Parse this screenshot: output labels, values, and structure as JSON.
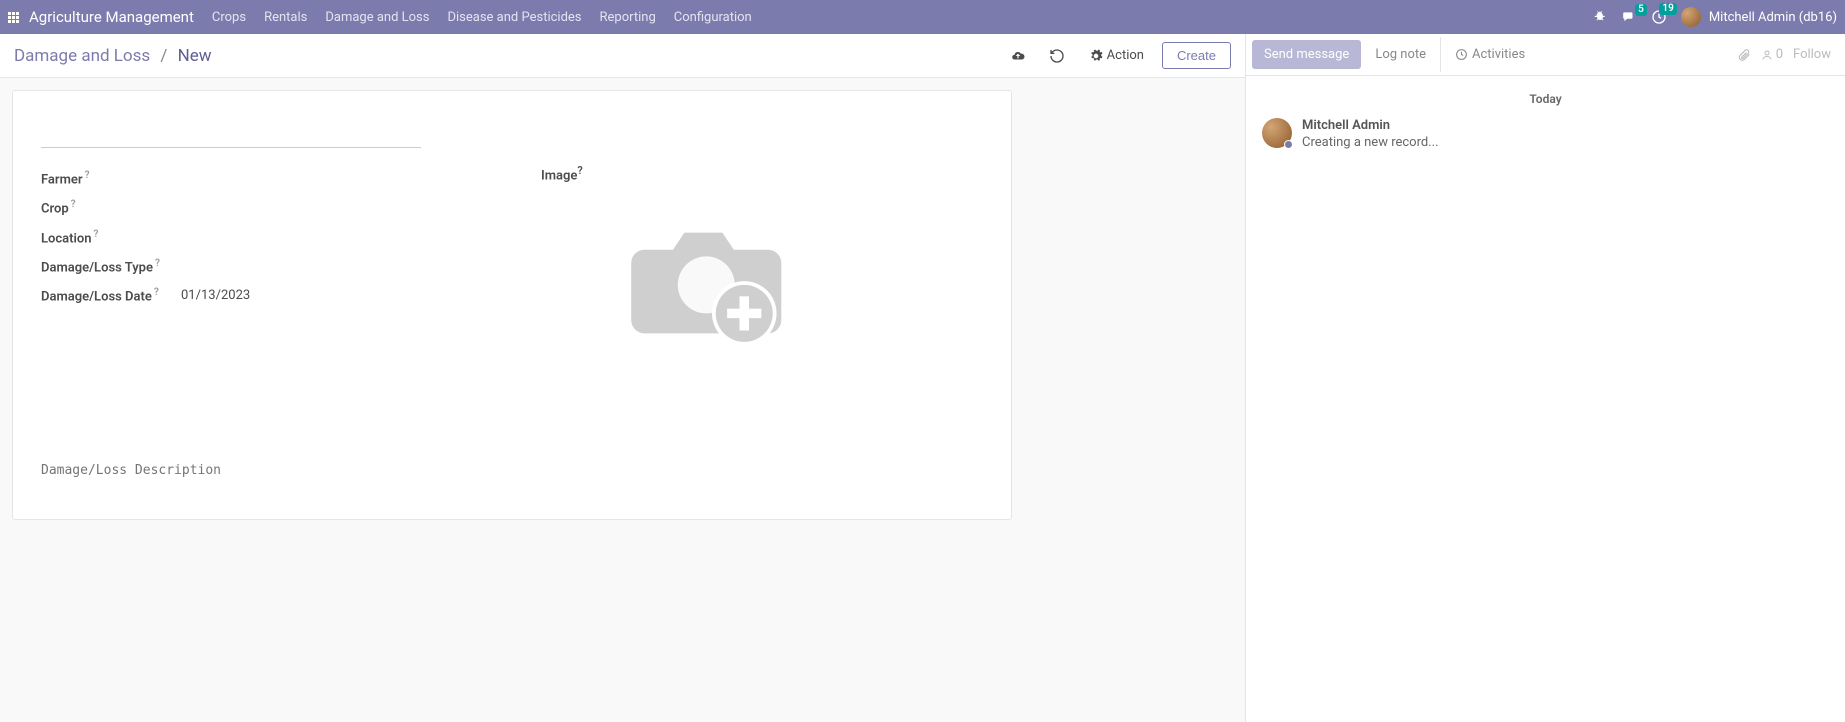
{
  "app": {
    "title": "Agriculture Management"
  },
  "nav": {
    "items": [
      "Crops",
      "Rentals",
      "Damage and Loss",
      "Disease and Pesticides",
      "Reporting",
      "Configuration"
    ]
  },
  "badges": {
    "chat": "5",
    "activities": "19"
  },
  "user": {
    "name": "Mitchell Admin (db16)"
  },
  "breadcrumb": {
    "root": "Damage and Loss",
    "current": "New"
  },
  "controls": {
    "action": "Action",
    "create": "Create"
  },
  "form": {
    "fields": {
      "farmer": "Farmer",
      "crop": "Crop",
      "location": "Location",
      "type": "Damage/Loss Type",
      "date": "Damage/Loss Date",
      "image": "Image"
    },
    "values": {
      "date": "01/13/2023"
    },
    "desc_placeholder": "Damage/Loss Description"
  },
  "chatter": {
    "send": "Send message",
    "log": "Log note",
    "activities": "Activities",
    "followers": "0",
    "follow": "Follow",
    "today": "Today",
    "msg": {
      "author": "Mitchell Admin",
      "text": "Creating a new record..."
    }
  }
}
